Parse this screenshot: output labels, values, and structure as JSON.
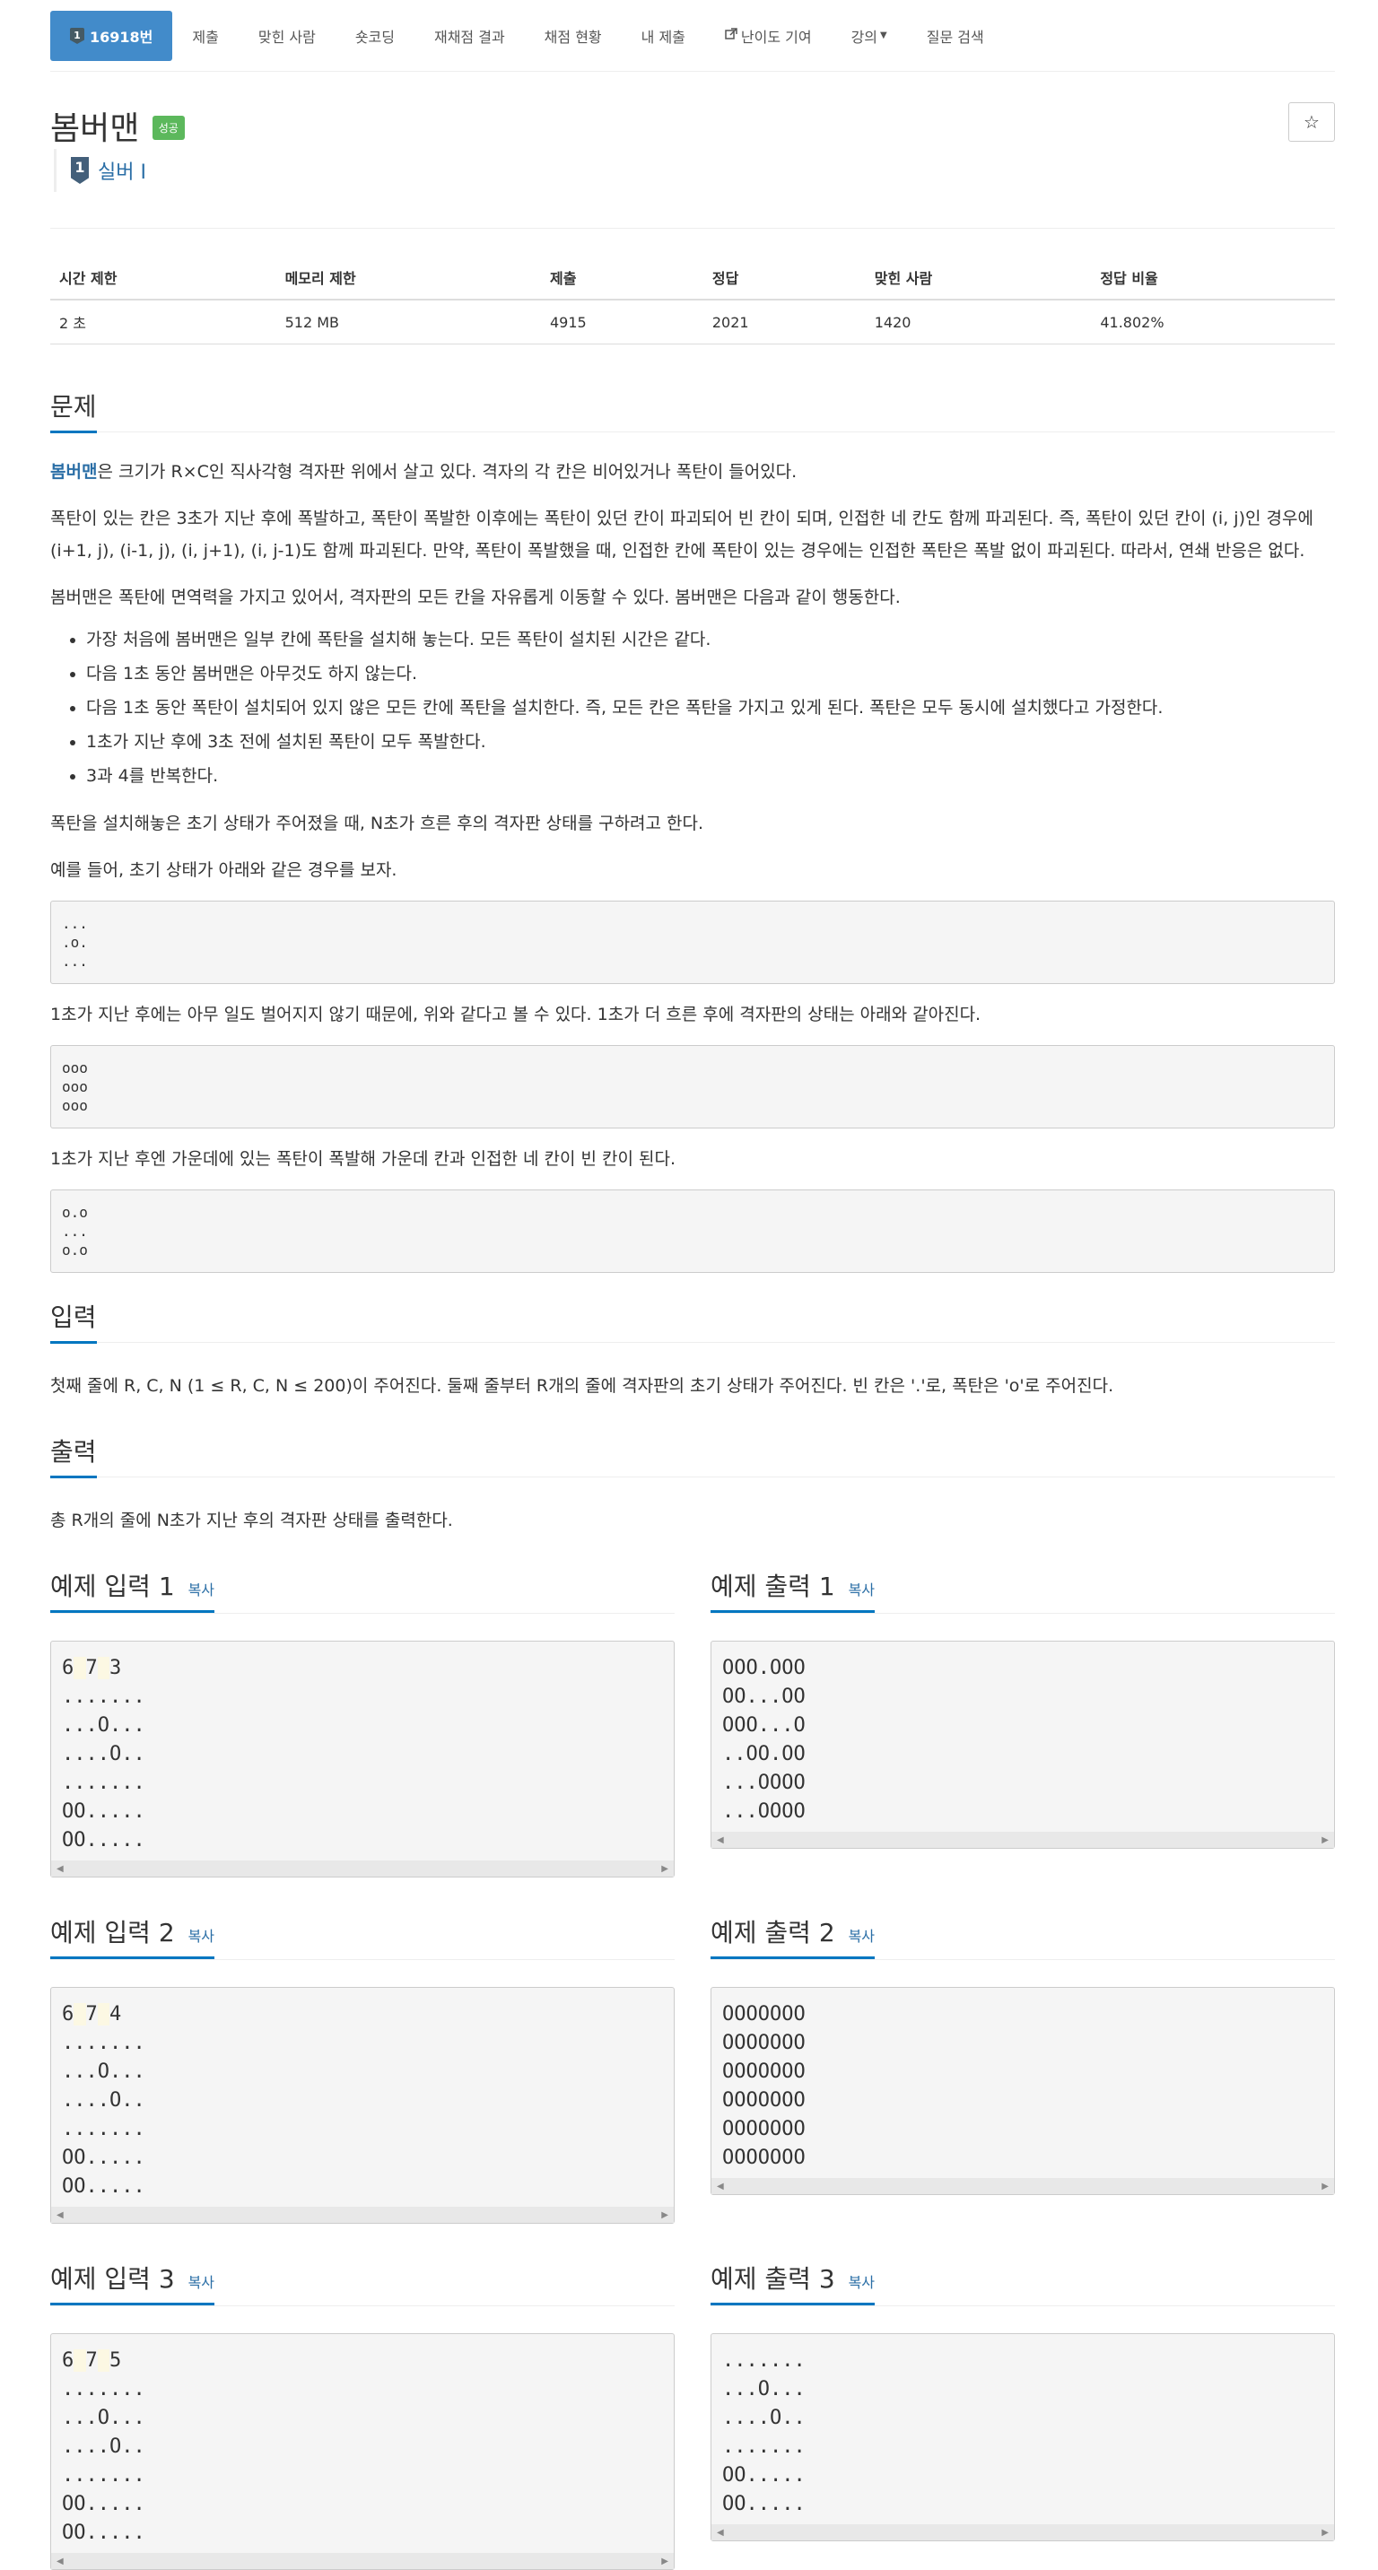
{
  "nav": {
    "tabs": [
      {
        "label": "16918번",
        "active": true
      },
      {
        "label": "제출"
      },
      {
        "label": "맞힌 사람"
      },
      {
        "label": "숏코딩"
      },
      {
        "label": "재채점 결과"
      },
      {
        "label": "채점 현황"
      },
      {
        "label": "내 제출"
      },
      {
        "label": "난이도 기여"
      },
      {
        "label": "강의"
      },
      {
        "label": "질문 검색"
      }
    ],
    "tier_icon_text": "1"
  },
  "problem": {
    "title": "봄버맨",
    "status_badge": "성공",
    "star_icon": "☆",
    "tier_number": "1",
    "tier_label": "실버 I"
  },
  "stats": {
    "headers": [
      "시간 제한",
      "메모리 제한",
      "제출",
      "정답",
      "맞힌 사람",
      "정답 비율"
    ],
    "values": [
      "2 초",
      "512 MB",
      "4915",
      "2021",
      "1420",
      "41.802%"
    ]
  },
  "description": {
    "section_title": "문제",
    "p1_link": "봄버맨",
    "p1_rest": "은 크기가 R×C인 직사각형 격자판 위에서 살고 있다. 격자의 각 칸은 비어있거나 폭탄이 들어있다.",
    "p2": "폭탄이 있는 칸은 3초가 지난 후에 폭발하고, 폭탄이 폭발한 이후에는 폭탄이 있던 칸이 파괴되어 빈 칸이 되며, 인접한 네 칸도 함께 파괴된다. 즉, 폭탄이 있던 칸이 (i, j)인 경우에 (i+1, j), (i-1, j), (i, j+1), (i, j-1)도 함께 파괴된다. 만약, 폭탄이 폭발했을 때, 인접한 칸에 폭탄이 있는 경우에는 인접한 폭탄은 폭발 없이 파괴된다. 따라서, 연쇄 반응은 없다.",
    "p3": "봄버맨은 폭탄에 면역력을 가지고 있어서, 격자판의 모든 칸을 자유롭게 이동할 수 있다. 봄버맨은 다음과 같이 행동한다.",
    "rules": [
      "가장 처음에 봄버맨은 일부 칸에 폭탄을 설치해 놓는다. 모든 폭탄이 설치된 시간은 같다.",
      "다음 1초 동안 봄버맨은 아무것도 하지 않는다.",
      "다음 1초 동안 폭탄이 설치되어 있지 않은 모든 칸에 폭탄을 설치한다. 즉, 모든 칸은 폭탄을 가지고 있게 된다. 폭탄은 모두 동시에 설치했다고 가정한다.",
      "1초가 지난 후에 3초 전에 설치된 폭탄이 모두 폭발한다.",
      "3과 4를 반복한다."
    ],
    "p4": "폭탄을 설치해놓은 초기 상태가 주어졌을 때, N초가 흐른 후의 격자판 상태를 구하려고 한다.",
    "p5": "예를 들어, 초기 상태가 아래와 같은 경우를 보자.",
    "grid1": "...\n.o.\n...",
    "p6": "1초가 지난 후에는 아무 일도 벌어지지 않기 때문에, 위와 같다고 볼 수 있다. 1초가 더 흐른 후에 격자판의 상태는 아래와 같아진다.",
    "grid2": "ooo\nooo\nooo",
    "p7": "1초가 지난 후엔 가운데에 있는 폭탄이 폭발해 가운데 칸과 인접한 네 칸이 빈 칸이 된다.",
    "grid3": "o.o\n...\no.o"
  },
  "input_section": {
    "title": "입력",
    "text": "첫째 줄에 R, C, N (1 ≤ R, C, N ≤ 200)이 주어진다. 둘째 줄부터 R개의 줄에 격자판의 초기 상태가 주어진다. 빈 칸은 '.'로, 폭탄은 'o'로 주어진다."
  },
  "output_section": {
    "title": "출력",
    "text": "총 R개의 줄에 N초가 지난 후의 격자판 상태를 출력한다."
  },
  "samples": {
    "copy_label": "복사",
    "in1_title": "예제 입력 1",
    "in1_first": [
      "6",
      "7",
      "3"
    ],
    "in1_grid": ".......\n...O...\n....O..\n.......\nOO.....\nOO.....",
    "out1_title": "예제 출력 1",
    "out1": "OOO.OOO\nOO...OO\nOOO...O\n..OO.OO\n...OOOO\n...OOOO",
    "in2_title": "예제 입력 2",
    "in2_first": [
      "6",
      "7",
      "4"
    ],
    "in2_grid": ".......\n...O...\n....O..\n.......\nOO.....\nOO.....",
    "out2_title": "예제 출력 2",
    "out2": "OOOOOOO\nOOOOOOO\nOOOOOOO\nOOOOOOO\nOOOOOOO\nOOOOOOO",
    "in3_title": "예제 입력 3",
    "in3_first": [
      "6",
      "7",
      "5"
    ],
    "in3_grid": ".......\n...O...\n....O..\n.......\nOO.....\nOO.....",
    "out3_title": "예제 출력 3",
    "out3": ".......\n...O...\n....O..\n.......\nOO.....\nOO....."
  }
}
